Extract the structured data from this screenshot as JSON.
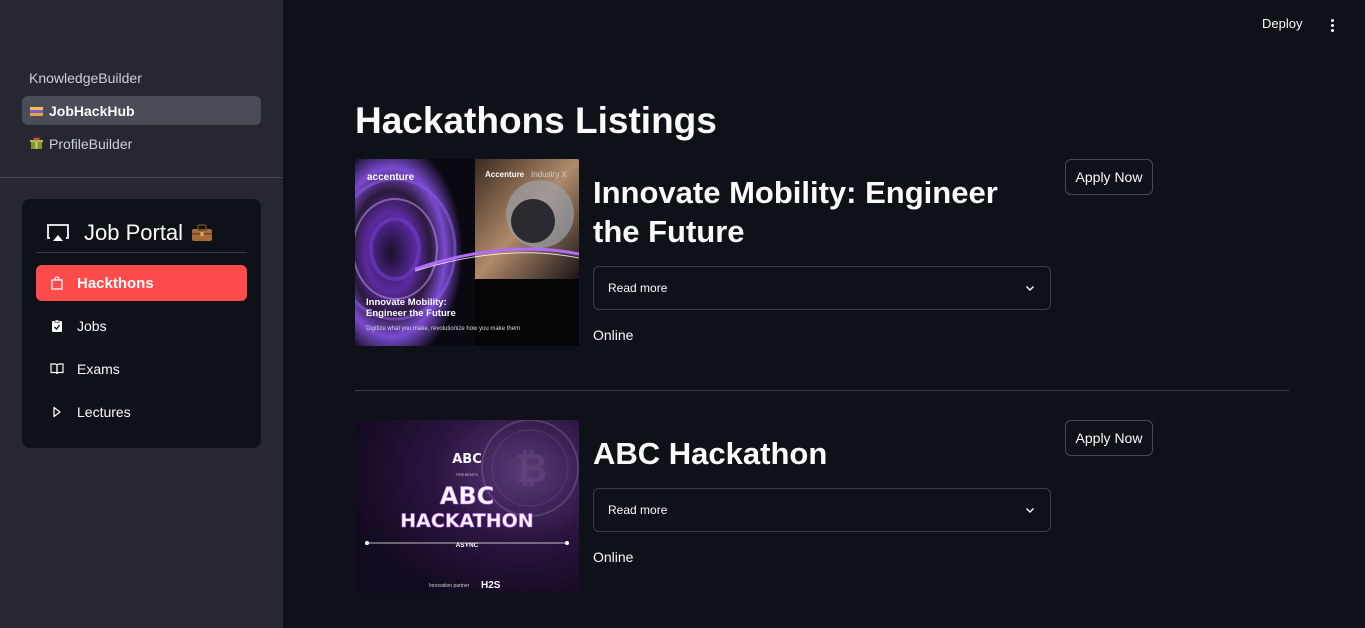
{
  "sidebar": {
    "pages": [
      {
        "label": "KnowledgeBuilder",
        "icon": "",
        "active": false
      },
      {
        "label": "JobHackHub",
        "icon": "briefcase-flag-icon",
        "active": true
      },
      {
        "label": "ProfileBuilder",
        "icon": "gift-icon",
        "active": false
      }
    ],
    "portal": {
      "title": "Job Portal",
      "title_icon": "briefcase-emoji-icon",
      "menu": [
        {
          "label": "Hackthons",
          "icon": "shopping-bag-icon",
          "active": true
        },
        {
          "label": "Jobs",
          "icon": "clipboard-check-icon",
          "active": false
        },
        {
          "label": "Exams",
          "icon": "book-open-icon",
          "active": false
        },
        {
          "label": "Lectures",
          "icon": "play-icon",
          "active": false
        }
      ]
    }
  },
  "header": {
    "deploy_label": "Deploy",
    "menu_icon": "kebab-menu-icon"
  },
  "main": {
    "title": "Hackathons Listings",
    "listings": [
      {
        "title": "Innovate Mobility: Engineer the Future",
        "expander_label": "Read more",
        "mode": "Online",
        "apply_label": "Apply Now",
        "image": {
          "brand_left": "accenture",
          "brand_right_bold": "Accenture",
          "brand_right_light": "Industry X",
          "headline": "Innovate Mobility: Engineer the Future",
          "tagline": "Digitize what you make, revolutionize how you make them"
        }
      },
      {
        "title": "ABC Hackathon",
        "expander_label": "Read more",
        "mode": "Online",
        "apply_label": "Apply Now",
        "image": {
          "logo": "ABC",
          "presents": "PRESENTS",
          "line1": "ABC",
          "line2": "HACKATHON",
          "sub": "ASYNC",
          "partner_label": "Innovation partner",
          "partner": "H2S"
        }
      }
    ]
  },
  "colors": {
    "background": "#0e1117",
    "sidebar": "#262730",
    "accent": "#ff4b4b",
    "active_page": "#4a4c58"
  }
}
